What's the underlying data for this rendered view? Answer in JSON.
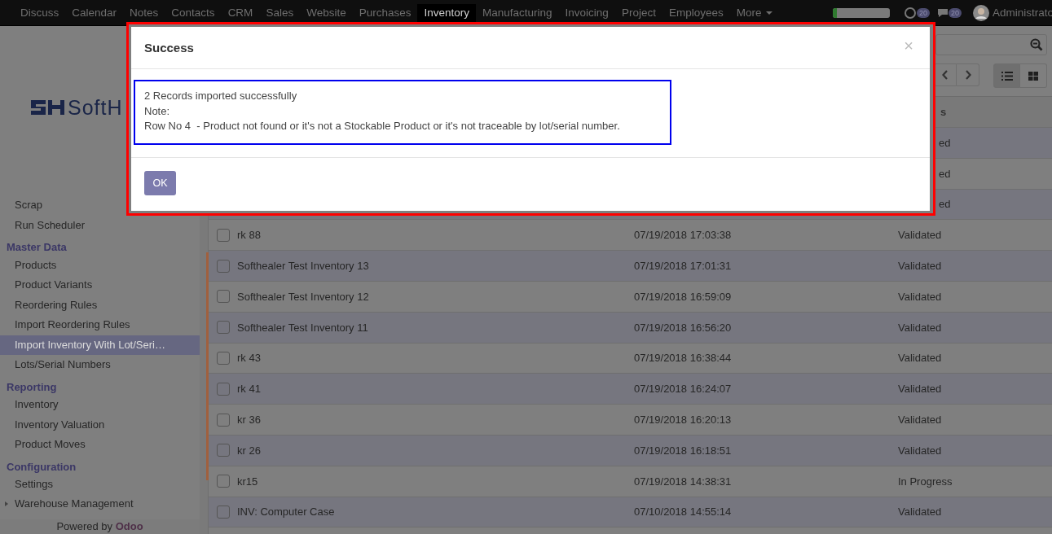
{
  "navbar": {
    "apps": [
      {
        "label": "Discuss",
        "selected": false
      },
      {
        "label": "Calendar",
        "selected": false
      },
      {
        "label": "Notes",
        "selected": false
      },
      {
        "label": "Contacts",
        "selected": false
      },
      {
        "label": "CRM",
        "selected": false
      },
      {
        "label": "Sales",
        "selected": false
      },
      {
        "label": "Website",
        "selected": false
      },
      {
        "label": "Purchases",
        "selected": false
      },
      {
        "label": "Inventory",
        "selected": true
      },
      {
        "label": "Manufacturing",
        "selected": false
      },
      {
        "label": "Invoicing",
        "selected": false
      },
      {
        "label": "Project",
        "selected": false
      },
      {
        "label": "Employees",
        "selected": false
      }
    ],
    "more": "More",
    "progress": {
      "level": 0.07
    },
    "activity_badge": "20",
    "messages_badge": "20",
    "user": "Administrato"
  },
  "sidebar": {
    "logo_text": "SoftH",
    "items": [
      {
        "kind": "item",
        "label": "Scrap",
        "selected": false
      },
      {
        "kind": "item",
        "label": "Run Scheduler",
        "selected": false
      },
      {
        "kind": "section",
        "label": "Master Data"
      },
      {
        "kind": "item",
        "label": "Products",
        "selected": false
      },
      {
        "kind": "item",
        "label": "Product Variants",
        "selected": false
      },
      {
        "kind": "item",
        "label": "Reordering Rules",
        "selected": false
      },
      {
        "kind": "item",
        "label": "Import Reordering Rules",
        "selected": false
      },
      {
        "kind": "item",
        "label": "Import Inventory With Lot/Seri…",
        "selected": true
      },
      {
        "kind": "item",
        "label": "Lots/Serial Numbers",
        "selected": false
      },
      {
        "kind": "section",
        "label": "Reporting"
      },
      {
        "kind": "item",
        "label": "Inventory",
        "selected": false
      },
      {
        "kind": "item",
        "label": "Inventory Valuation",
        "selected": false
      },
      {
        "kind": "item",
        "label": "Product Moves",
        "selected": false
      },
      {
        "kind": "section",
        "label": "Configuration"
      },
      {
        "kind": "item",
        "label": "Settings",
        "selected": false
      },
      {
        "kind": "group",
        "label": "Warehouse Management",
        "expanded": false
      }
    ],
    "powered_by": "Powered by",
    "brand": "Odoo"
  },
  "list": {
    "header_status": "s",
    "rows": [
      {
        "status": "ed"
      },
      {
        "status": "ed"
      },
      {
        "status": "ed"
      },
      {
        "name": "rk 88",
        "date": "07/19/2018 17:03:38",
        "status": "Validated",
        "checked": false
      },
      {
        "name": "Softhealer Test Inventory 13",
        "date": "07/19/2018 17:01:31",
        "status": "Validated",
        "checked": false
      },
      {
        "name": "Softhealer Test Inventory 12",
        "date": "07/19/2018 16:59:09",
        "status": "Validated",
        "checked": false
      },
      {
        "name": "Softhealer Test Inventory 11",
        "date": "07/19/2018 16:56:20",
        "status": "Validated",
        "checked": false
      },
      {
        "name": "rk 43",
        "date": "07/19/2018 16:38:44",
        "status": "Validated",
        "checked": false
      },
      {
        "name": "rk 41",
        "date": "07/19/2018 16:24:07",
        "status": "Validated",
        "checked": false
      },
      {
        "name": "kr 36",
        "date": "07/19/2018 16:20:13",
        "status": "Validated",
        "checked": false
      },
      {
        "name": "kr 26",
        "date": "07/19/2018 16:18:51",
        "status": "Validated",
        "checked": false
      },
      {
        "name": "kr15",
        "date": "07/19/2018 14:38:31",
        "status": "In Progress",
        "checked": false
      },
      {
        "name": "INV: Computer Case",
        "date": "07/10/2018 14:55:14",
        "status": "Validated",
        "checked": false
      }
    ]
  },
  "modal": {
    "title": "Success",
    "close": "×",
    "lines": [
      "2 Records imported successfully",
      "Note:",
      "Row No 4  - Product not found or it's not a Stockable Product or it's not traceable by lot/serial number."
    ],
    "ok": "OK"
  }
}
